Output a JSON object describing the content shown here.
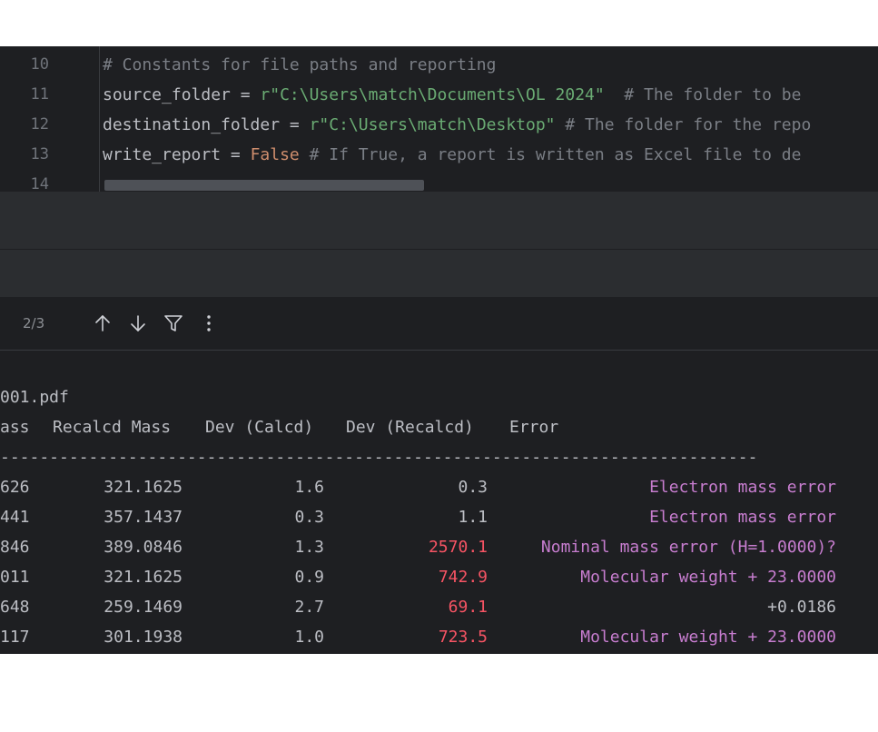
{
  "editor": {
    "lines": [
      {
        "num": "10",
        "comment": "# Constants for file paths and reporting"
      },
      {
        "num": "11",
        "ident": "source_folder",
        "op": " = ",
        "string": "r\"C:\\Users\\match\\Documents\\OL 2024\"",
        "comment": "  # The folder to be"
      },
      {
        "num": "12",
        "ident": "destination_folder",
        "op": " = ",
        "string": "r\"C:\\Users\\match\\Desktop\"",
        "comment": " # The folder for the repo"
      },
      {
        "num": "13",
        "ident": "write_report",
        "op": " = ",
        "keyword": "False",
        "comment": " # If True, a report is written as Excel file to de"
      },
      {
        "num": "14"
      }
    ]
  },
  "search": {
    "match_count": "2/3",
    "icons": [
      "arrow-up-icon",
      "arrow-down-icon",
      "filter-icon",
      "more-vertical-icon"
    ]
  },
  "console": {
    "filename": "001.pdf",
    "headers": {
      "mass": "ass",
      "recalcd_mass": "Recalcd Mass",
      "dev_calcd": "Dev (Calcd)",
      "dev_recalcd": "Dev (Recalcd)",
      "error": "Error"
    },
    "separator": "-----------------------------------------------------------------------------",
    "rows": [
      {
        "mass": "626",
        "recalcd": "321.1625",
        "dev_calcd": "1.6",
        "dev_recalcd": "0.3",
        "dev_recalcd_color": "normal",
        "error": "Electron mass error",
        "error_color": "purple"
      },
      {
        "mass": "441",
        "recalcd": "357.1437",
        "dev_calcd": "0.3",
        "dev_recalcd": "1.1",
        "dev_recalcd_color": "normal",
        "error": "Electron mass error",
        "error_color": "purple"
      },
      {
        "mass": "846",
        "recalcd": "389.0846",
        "dev_calcd": "1.3",
        "dev_recalcd": "2570.1",
        "dev_recalcd_color": "red",
        "error": "Nominal mass error (H=1.0000)?",
        "error_color": "purple"
      },
      {
        "mass": "011",
        "recalcd": "321.1625",
        "dev_calcd": "0.9",
        "dev_recalcd": "742.9",
        "dev_recalcd_color": "red",
        "error": "Molecular weight + 23.0000",
        "error_color": "purple"
      },
      {
        "mass": "648",
        "recalcd": "259.1469",
        "dev_calcd": "2.7",
        "dev_recalcd": "69.1",
        "dev_recalcd_color": "red",
        "error": "+0.0186",
        "error_color": "normal"
      },
      {
        "mass": "117",
        "recalcd": "301.1938",
        "dev_calcd": "1.0",
        "dev_recalcd": "723.5",
        "dev_recalcd_color": "red",
        "error": "Molecular weight + 23.0000",
        "error_color": "purple"
      }
    ]
  },
  "colors": {
    "background": "#1e1f22",
    "panel": "#2b2d30",
    "comment": "#7a7e85",
    "string": "#6aab73",
    "keyword": "#cf8e6d",
    "error_red": "#f75464",
    "error_purple": "#c77dcf"
  }
}
